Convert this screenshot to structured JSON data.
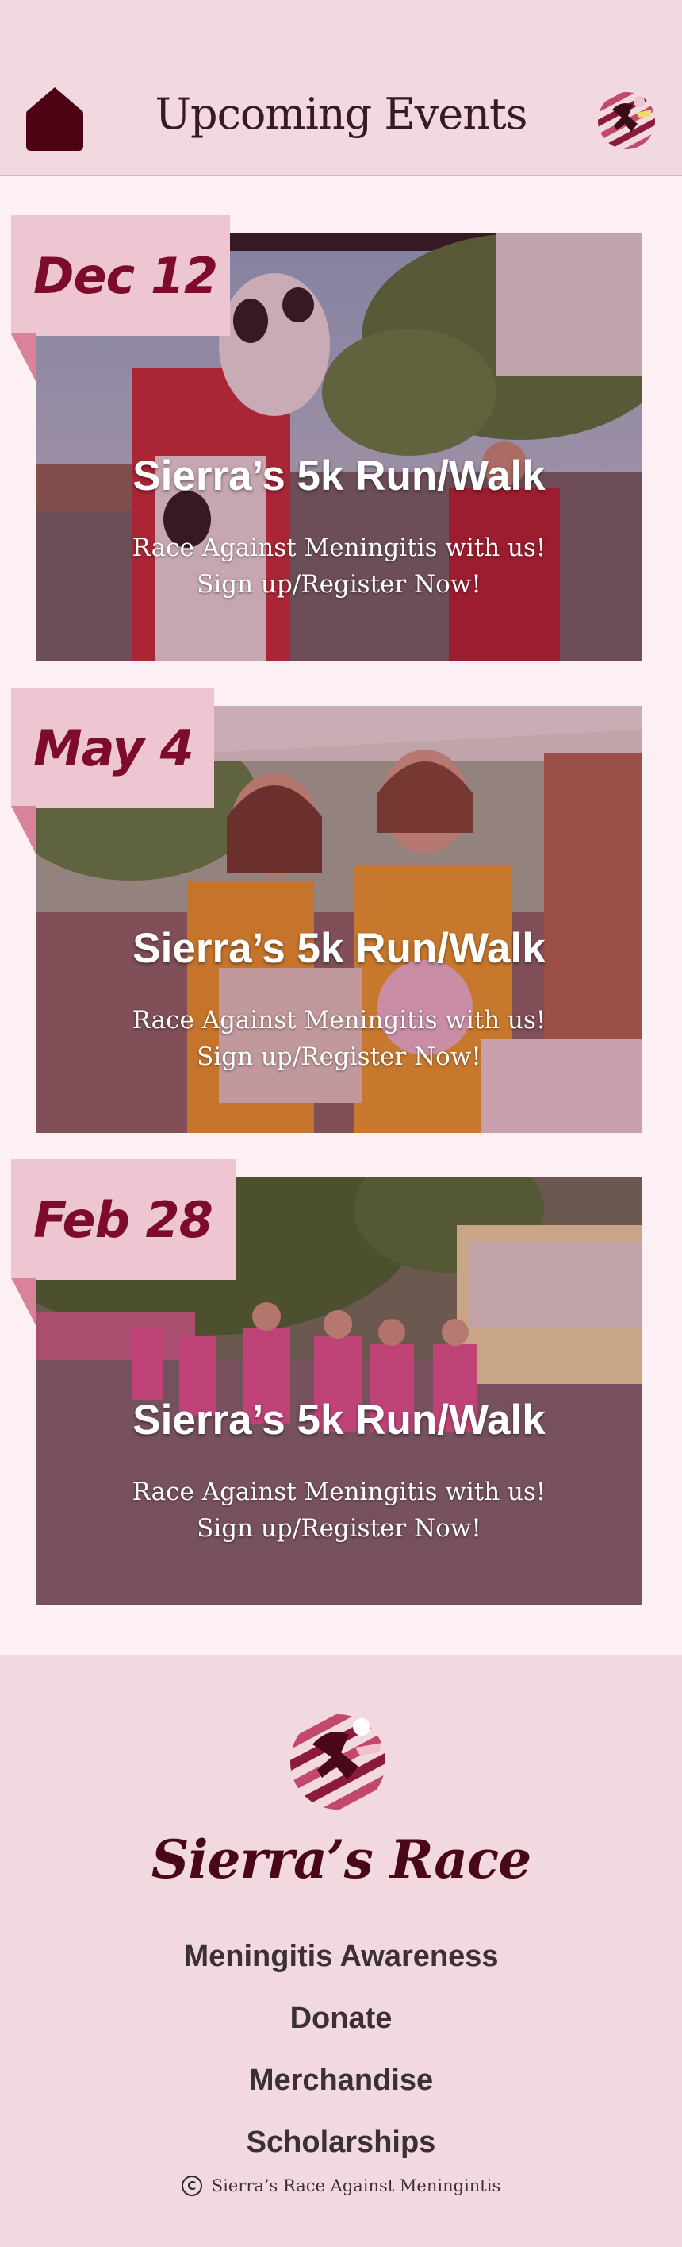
{
  "header": {
    "title": "Upcoming Events",
    "home_icon": "home-icon",
    "logo_icon": "runner-logo-icon"
  },
  "events": [
    {
      "date": "Dec 12",
      "title": "Sierra’s 5k Run/Walk",
      "desc_line1": "Race Against Meningitis with us!",
      "desc_line2": "Sign up/Register Now!"
    },
    {
      "date": "May 4",
      "title": "Sierra’s 5k Run/Walk",
      "desc_line1": "Race Against Meningitis with us!",
      "desc_line2": "Sign up/Register Now!"
    },
    {
      "date": "Feb 28",
      "title": "Sierra’s 5k Run/Walk",
      "desc_line1": "Race Against Meningitis with us!",
      "desc_line2": "Sign up/Register Now!"
    }
  ],
  "footer": {
    "brand": "Sierra’s Race",
    "links": [
      "Meningitis Awareness",
      "Donate",
      "Merchandise",
      "Scholarships"
    ],
    "copyright_symbol": "C",
    "copyright": "Sierra’s Race Against Meningintis"
  },
  "colors": {
    "header_bg": "#f1d9df",
    "page_bg": "#fdf0f4",
    "accent": "#7d0b2c",
    "date_tab": "#eec6d1",
    "brand_dark": "#4a0718"
  }
}
